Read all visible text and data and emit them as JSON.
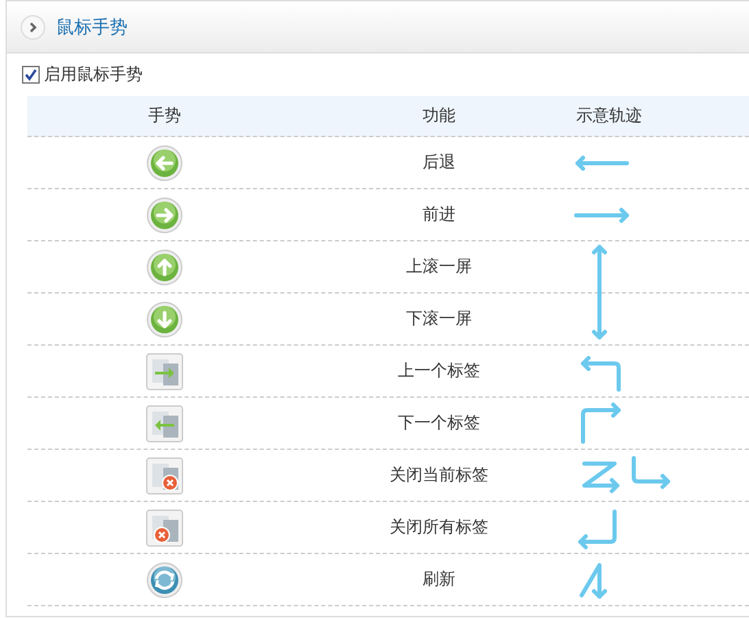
{
  "panel": {
    "title": "鼠标手势"
  },
  "enable": {
    "label": "启用鼠标手势",
    "checked": true
  },
  "table": {
    "columns": [
      "手势",
      "功能",
      "示意轨迹"
    ],
    "rows": [
      {
        "kind": "back",
        "function": "后退"
      },
      {
        "kind": "forward",
        "function": "前进"
      },
      {
        "kind": "up",
        "function": "上滚一屏"
      },
      {
        "kind": "down",
        "function": "下滚一屏"
      },
      {
        "kind": "prev-tab",
        "function": "上一个标签"
      },
      {
        "kind": "next-tab",
        "function": "下一个标签"
      },
      {
        "kind": "close-tab",
        "function": "关闭当前标签"
      },
      {
        "kind": "close-all",
        "function": "关闭所有标签"
      },
      {
        "kind": "refresh",
        "function": "刷新"
      }
    ]
  }
}
